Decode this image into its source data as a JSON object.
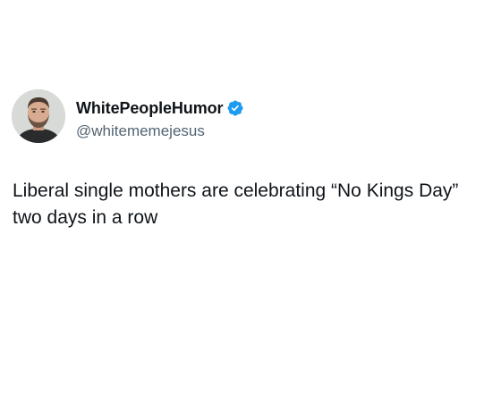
{
  "post": {
    "author": {
      "display_name": "WhitePeopleHumor",
      "handle": "@whitememejesus",
      "verified": true,
      "verified_icon": "verified-badge-icon"
    },
    "text": "Liberal single mothers are celebrating “No Kings Day” two days in a row"
  },
  "colors": {
    "background": "#ffffff",
    "text_primary": "#0f1419",
    "text_secondary": "#536471",
    "verified_blue": "#1d9bf0"
  }
}
